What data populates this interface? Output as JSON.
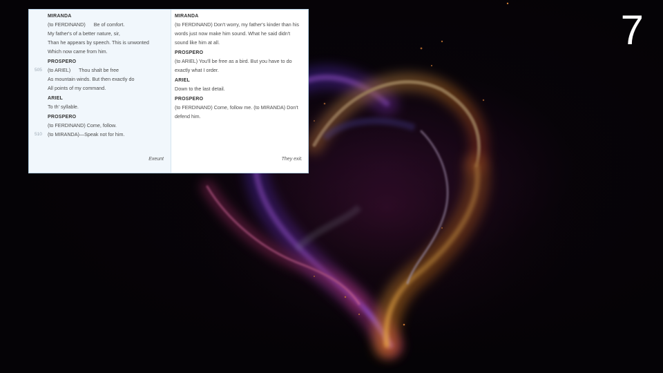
{
  "slide": {
    "number": "7"
  },
  "original_text": {
    "speeches": [
      {
        "speaker": "MIRANDA",
        "lines": [
          {
            "no": "",
            "text": "(to FERDINAND)      Be of comfort."
          },
          {
            "no": "",
            "text": "My father's of a better nature, sir,"
          },
          {
            "no": "",
            "text": "Than he appears by speech. This is unwonted"
          },
          {
            "no": "",
            "text": "Which now came from him."
          }
        ]
      },
      {
        "speaker": "PROSPERO",
        "lines": [
          {
            "no": "505",
            "text": "(to ARIEL)      Thou shalt be free"
          },
          {
            "no": "",
            "text": "As mountain winds. But then exactly do"
          },
          {
            "no": "",
            "text": "All points of my command."
          }
        ]
      },
      {
        "speaker": "ARIEL",
        "lines": [
          {
            "no": "",
            "text": "To th' syllable."
          }
        ]
      },
      {
        "speaker": "PROSPERO",
        "lines": [
          {
            "no": "",
            "text": "(to FERDINAND) Come, follow."
          },
          {
            "no": "510",
            "text": "(to MIRANDA)—Speak not for him."
          }
        ]
      }
    ],
    "exit": "Exeunt"
  },
  "modern_text": {
    "speeches": [
      {
        "speaker": "MIRANDA",
        "lines": [
          "(to FERDINAND) Don't worry, my father's kinder than his",
          "words just now make him sound. What he said didn't",
          "sound like him at all."
        ]
      },
      {
        "speaker": "PROSPERO",
        "lines": [
          "(to ARIEL) You'll be free as a bird. But you have to do",
          "exactly what I order."
        ]
      },
      {
        "speaker": "ARIEL",
        "lines": [
          "Down to the last detail."
        ]
      },
      {
        "speaker": "PROSPERO",
        "lines": [
          "(to FERDINAND) Come, follow me. (to MIRANDA) Don't",
          "defend him."
        ]
      }
    ],
    "exit": "They exit."
  },
  "colors": {
    "background": "#050306",
    "panel_border": "#b9d4ea",
    "original_column_bg": "#f1f7fc",
    "flame_purple": "#6a2bd9",
    "flame_orange": "#f09a2a",
    "flame_pink": "#e0408a"
  },
  "background_art": "flaming-heart-image"
}
